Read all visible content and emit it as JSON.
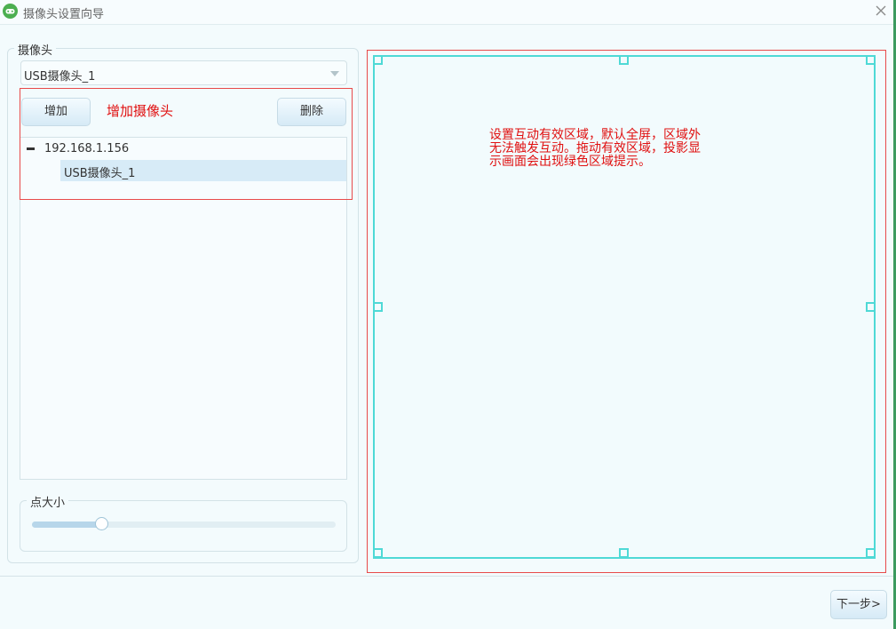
{
  "window": {
    "title": "摄像头设置向导",
    "app_icon": "gamepad-icon",
    "close_icon": "close-icon"
  },
  "camera_group": {
    "legend": "摄像头",
    "selected_camera": "USB摄像头_1",
    "add_button": "增加",
    "delete_button": "删除",
    "annotation_add": "增加摄像头",
    "tree": {
      "node_label": "192.168.1.156",
      "child_label": "USB摄像头_1"
    }
  },
  "point_size": {
    "legend": "点大小",
    "value_fraction": 0.23
  },
  "preview": {
    "annotation_text": "设置互动有效区域，默认全屏，区域外\n无法触发互动。拖动有效区域，投影显\n示画面会出现绿色区域提示。"
  },
  "footer": {
    "next_button": "下一步>"
  },
  "colors": {
    "annotation_red": "#e01010",
    "region_cyan": "#4fd9d6",
    "background": "#f3fbfd"
  }
}
